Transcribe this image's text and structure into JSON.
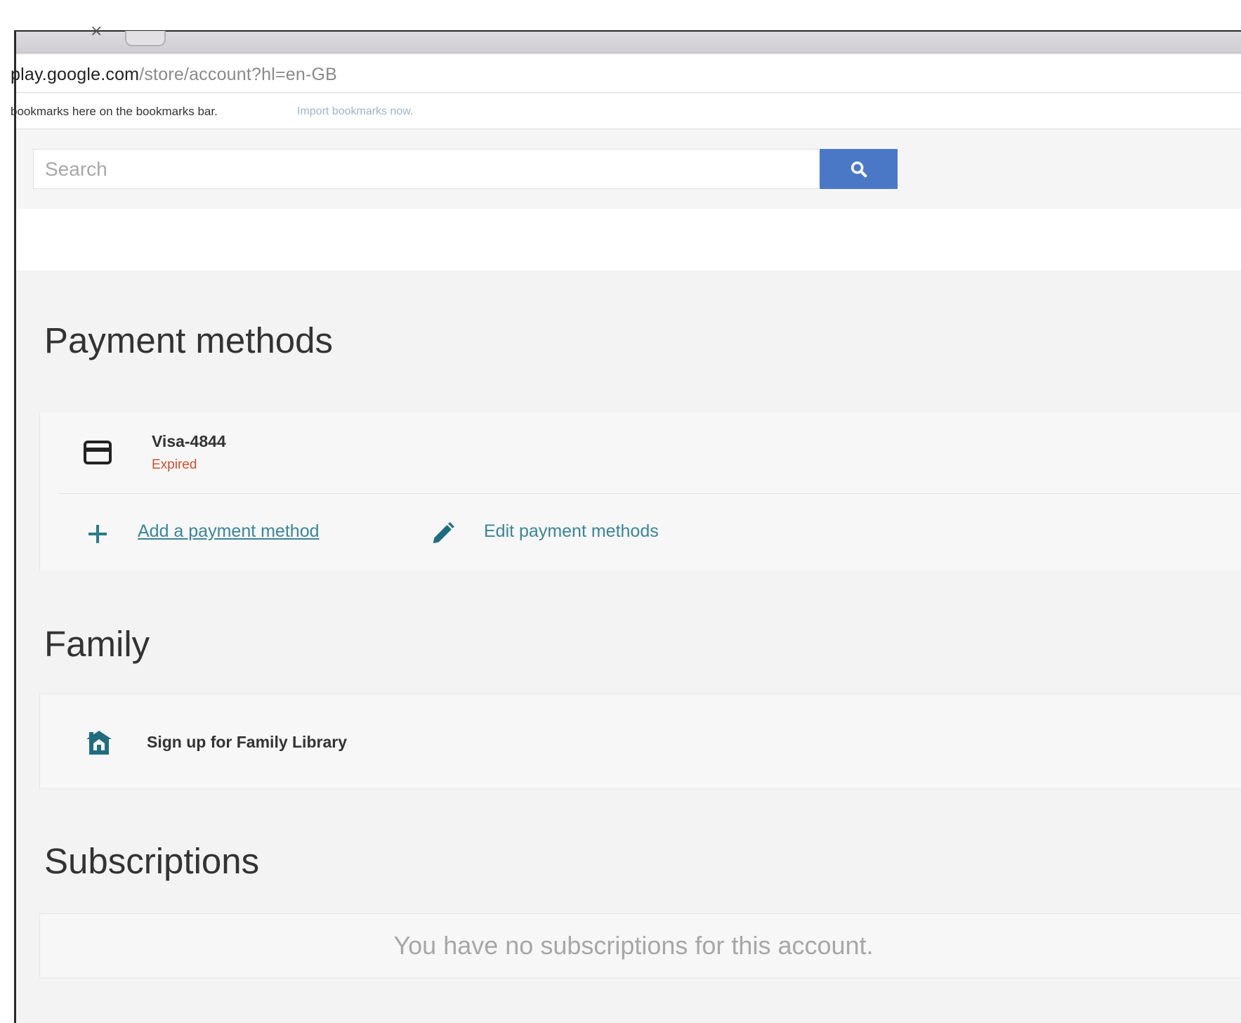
{
  "browser": {
    "tab_close_glyph": "×",
    "url_host": "play.google.com",
    "url_path": "/store/account?hl=en-GB",
    "bookmarks_bar_text": "bookmarks here on the bookmarks bar.",
    "bookmarks_import_link": "Import bookmarks now."
  },
  "search": {
    "placeholder": "Search",
    "icon": "search-icon",
    "button_color": "#4a78c7"
  },
  "payment_methods": {
    "title": "Payment methods",
    "items": [
      {
        "icon": "credit-card-icon",
        "name": "Visa-4844",
        "status": "Expired",
        "status_color": "#d14f2a"
      }
    ],
    "add_label": "Add a payment method",
    "add_icon": "plus-icon",
    "edit_label": "Edit payment methods",
    "edit_icon": "pencil-icon",
    "link_color": "#3a8599"
  },
  "family": {
    "title": "Family",
    "item_label": "Sign up for Family Library",
    "item_icon": "family-home-icon"
  },
  "subscriptions": {
    "title": "Subscriptions",
    "empty_message": "You have no subscriptions for this account."
  }
}
